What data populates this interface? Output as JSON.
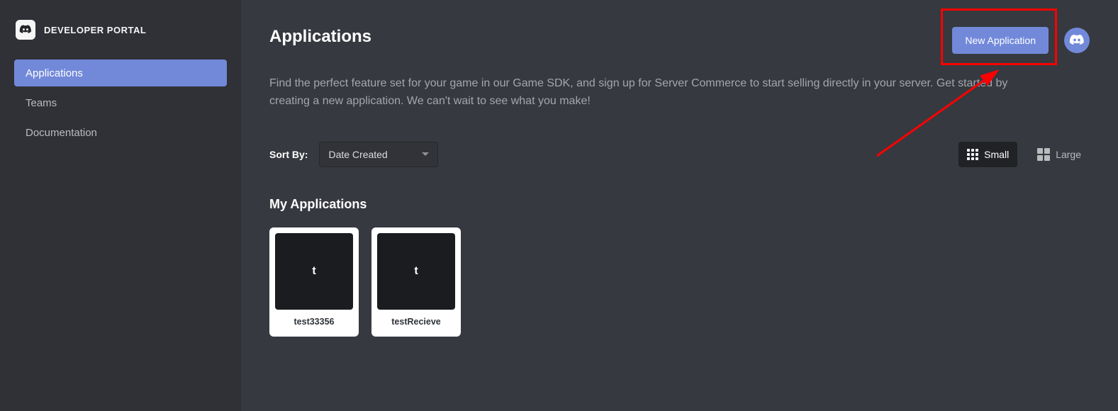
{
  "brand": "DEVELOPER PORTAL",
  "nav": {
    "items": [
      {
        "label": "Applications",
        "active": true
      },
      {
        "label": "Teams",
        "active": false
      },
      {
        "label": "Documentation",
        "active": false
      }
    ]
  },
  "header": {
    "title": "Applications",
    "new_button": "New Application"
  },
  "description": "Find the perfect feature set for your game in our Game SDK, and sign up for Server Commerce to start selling directly in your server. Get started by creating a new application. We can't wait to see what you make!",
  "sort": {
    "label": "Sort By:",
    "selected": "Date Created"
  },
  "view": {
    "small": "Small",
    "large": "Large"
  },
  "section_title": "My Applications",
  "apps": [
    {
      "letter": "t",
      "name": "test33356"
    },
    {
      "letter": "t",
      "name": "testRecieve"
    }
  ]
}
